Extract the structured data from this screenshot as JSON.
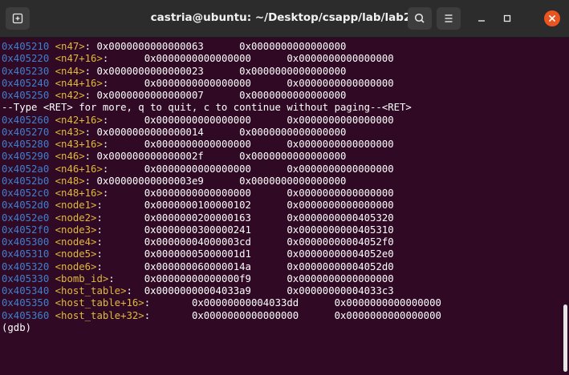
{
  "window": {
    "title": "castria@ubuntu: ~/Desktop/csapp/lab/lab2",
    "colors": {
      "background": "#300a24",
      "titlebar": "#2c2c2c",
      "address": "#3f7fd0",
      "symbol": "#e0b93a",
      "close": "#e9541f"
    },
    "icons": {
      "new_tab": "new-tab-icon",
      "search": "search-icon",
      "menu": "hamburger-menu-icon",
      "minimize": "minimize-icon",
      "maximize": "maximize-icon",
      "close": "close-icon"
    }
  },
  "terminal": {
    "lines": [
      {
        "addr": "0x405210",
        "sym": "<n47>",
        "tail": ": ",
        "v1": "0x0000000000000063",
        "gap": "      ",
        "v2": "0x0000000000000000"
      },
      {
        "addr": "0x405220",
        "sym": "<n47+16>",
        "tail": ":      ",
        "v1": "0x0000000000000000",
        "gap": "      ",
        "v2": "0x0000000000000000"
      },
      {
        "addr": "0x405230",
        "sym": "<n44>",
        "tail": ": ",
        "v1": "0x0000000000000023",
        "gap": "      ",
        "v2": "0x0000000000000000"
      },
      {
        "addr": "0x405240",
        "sym": "<n44+16>",
        "tail": ":      ",
        "v1": "0x0000000000000000",
        "gap": "      ",
        "v2": "0x0000000000000000"
      },
      {
        "addr": "0x405250",
        "sym": "<n42>",
        "tail": ": ",
        "v1": "0x0000000000000007",
        "gap": "      ",
        "v2": "0x0000000000000000"
      },
      {
        "text": "--Type <RET> for more, q to quit, c to continue without paging--<RET>"
      },
      {
        "addr": "0x405260",
        "sym": "<n42+16>",
        "tail": ":      ",
        "v1": "0x0000000000000000",
        "gap": "      ",
        "v2": "0x0000000000000000"
      },
      {
        "addr": "0x405270",
        "sym": "<n43>",
        "tail": ": ",
        "v1": "0x0000000000000014",
        "gap": "      ",
        "v2": "0x0000000000000000"
      },
      {
        "addr": "0x405280",
        "sym": "<n43+16>",
        "tail": ":      ",
        "v1": "0x0000000000000000",
        "gap": "      ",
        "v2": "0x0000000000000000"
      },
      {
        "addr": "0x405290",
        "sym": "<n46>",
        "tail": ": ",
        "v1": "0x000000000000002f",
        "gap": "      ",
        "v2": "0x0000000000000000"
      },
      {
        "addr": "0x4052a0",
        "sym": "<n46+16>",
        "tail": ":      ",
        "v1": "0x0000000000000000",
        "gap": "      ",
        "v2": "0x0000000000000000"
      },
      {
        "addr": "0x4052b0",
        "sym": "<n48>",
        "tail": ": ",
        "v1": "0x00000000000003e9",
        "gap": "      ",
        "v2": "0x0000000000000000"
      },
      {
        "addr": "0x4052c0",
        "sym": "<n48+16>",
        "tail": ":      ",
        "v1": "0x0000000000000000",
        "gap": "      ",
        "v2": "0x0000000000000000"
      },
      {
        "addr": "0x4052d0",
        "sym": "<node1>",
        "tail": ":       ",
        "v1": "0x0000000100000102",
        "gap": "      ",
        "v2": "0x0000000000000000"
      },
      {
        "addr": "0x4052e0",
        "sym": "<node2>",
        "tail": ":       ",
        "v1": "0x0000000200000163",
        "gap": "      ",
        "v2": "0x0000000000405320"
      },
      {
        "addr": "0x4052f0",
        "sym": "<node3>",
        "tail": ":       ",
        "v1": "0x0000000300000241",
        "gap": "      ",
        "v2": "0x0000000000405310"
      },
      {
        "addr": "0x405300",
        "sym": "<node4>",
        "tail": ":       ",
        "v1": "0x00000004000003cd",
        "gap": "      ",
        "v2": "0x00000000004052f0"
      },
      {
        "addr": "0x405310",
        "sym": "<node5>",
        "tail": ":       ",
        "v1": "0x00000005000001d1",
        "gap": "      ",
        "v2": "0x00000000004052e0"
      },
      {
        "addr": "0x405320",
        "sym": "<node6>",
        "tail": ":       ",
        "v1": "0x000000060000014a",
        "gap": "      ",
        "v2": "0x00000000004052d0"
      },
      {
        "addr": "0x405330",
        "sym": "<bomb_id>",
        "tail": ":     ",
        "v1": "0x00000000000000f9",
        "gap": "      ",
        "v2": "0x0000000000000000"
      },
      {
        "addr": "0x405340",
        "sym": "<host_table>",
        "tail": ":  ",
        "v1": "0x00000000004033a9",
        "gap": "      ",
        "v2": "0x00000000004033c3"
      },
      {
        "addr": "0x405350",
        "sym": "<host_table+16>",
        "tail": ":       ",
        "v1": "0x00000000004033dd",
        "gap": "      ",
        "v2": "0x0000000000000000"
      },
      {
        "addr": "0x405360",
        "sym": "<host_table+32>",
        "tail": ":       ",
        "v1": "0x0000000000000000",
        "gap": "      ",
        "v2": "0x0000000000000000"
      },
      {
        "text": "(gdb) "
      }
    ]
  }
}
